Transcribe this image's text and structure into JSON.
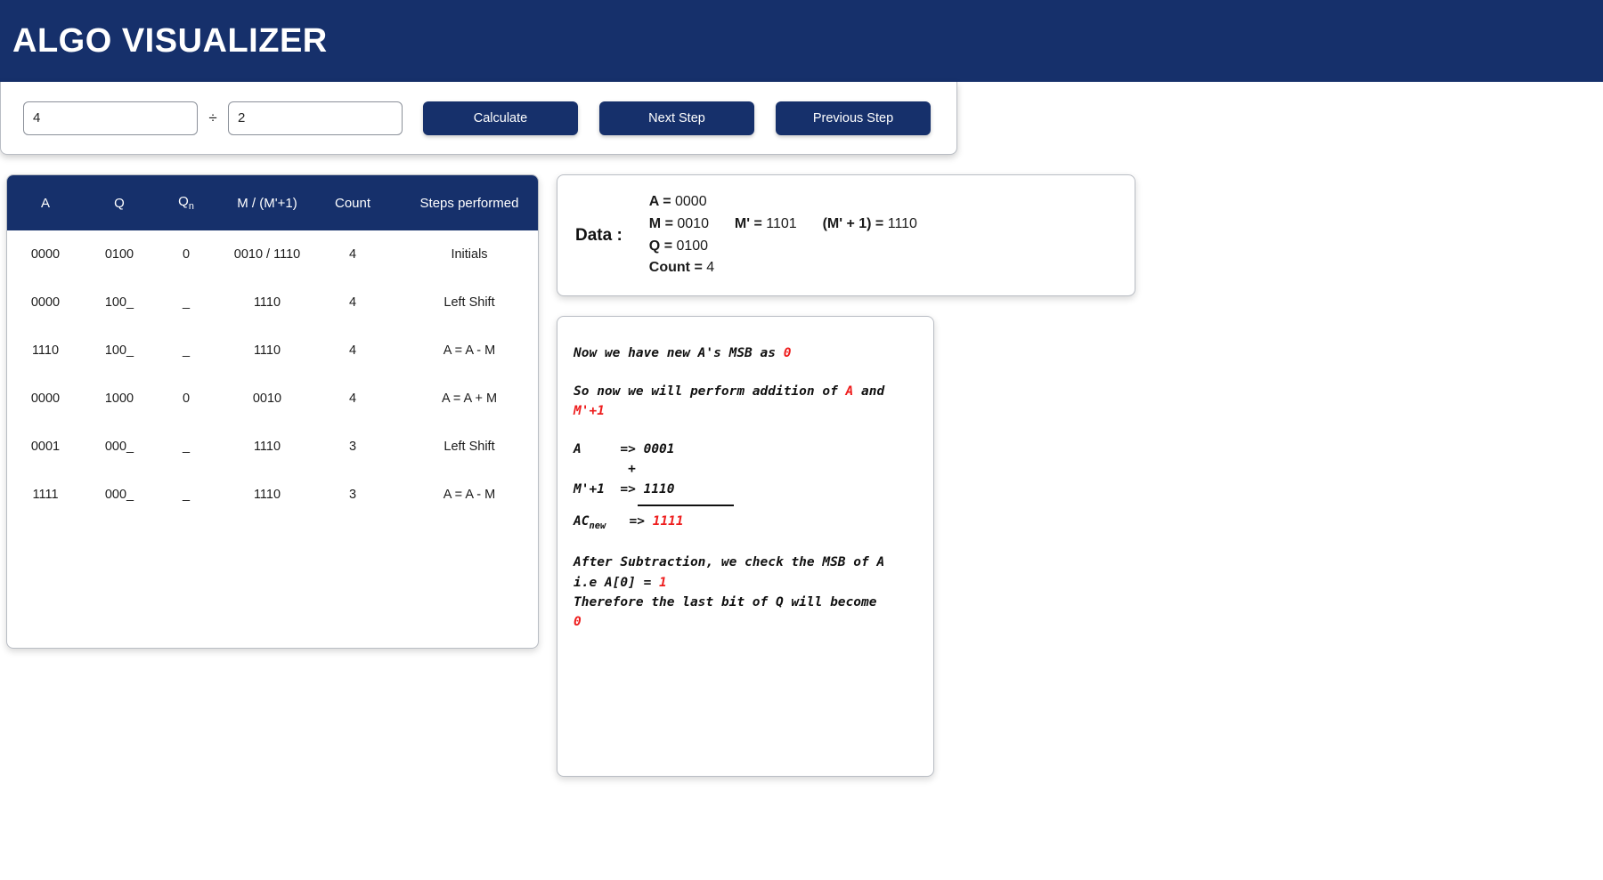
{
  "header": {
    "title": "ALGO VISUALIZER"
  },
  "controls": {
    "dividend_value": "4",
    "dividend_placeholder": "",
    "divisor_value": "2",
    "divisor_placeholder": "",
    "divide_symbol": "÷",
    "calculate_label": "Calculate",
    "next_step_label": "Next Step",
    "previous_step_label": "Previous Step"
  },
  "table": {
    "headers": [
      "A",
      "Q",
      "Qn",
      "M / (M'+1)",
      "Count",
      "Steps performed"
    ],
    "header_qn_base": "Q",
    "header_qn_sub": "n",
    "rows": [
      {
        "a": "0000",
        "q": "0100",
        "qn": "0",
        "m": "0010 / 1110",
        "count": "4",
        "step": "Initials"
      },
      {
        "a": "0000",
        "q": "100_",
        "qn": "_",
        "m": "1110",
        "count": "4",
        "step": "Left Shift"
      },
      {
        "a": "1110",
        "q": "100_",
        "qn": "_",
        "m": "1110",
        "count": "4",
        "step": "A = A - M"
      },
      {
        "a": "0000",
        "q": "1000",
        "qn": "0",
        "m": "0010",
        "count": "4",
        "step": "A = A + M"
      },
      {
        "a": "0001",
        "q": "000_",
        "qn": "_",
        "m": "1110",
        "count": "3",
        "step": "Left Shift"
      },
      {
        "a": "1111",
        "q": "000_",
        "qn": "_",
        "m": "1110",
        "count": "3",
        "step": "A = A - M"
      }
    ]
  },
  "data_panel": {
    "label": "Data :",
    "a_label": "A =",
    "a_value": "0000",
    "m_label": "M =",
    "m_value": "0010",
    "mprime_label": "M' =",
    "mprime_value": "1101",
    "mprime1_label": "(M' + 1) =",
    "mprime1_value": "1110",
    "q_label": "Q =",
    "q_value": "0100",
    "count_label": "Count =",
    "count_value": "4"
  },
  "explanation": {
    "line1_pre": "Now we have new A's MSB as ",
    "line1_red": "0",
    "line2_pre": "So now we will perform addition of ",
    "line2_red1": "A",
    "line2_mid": " and ",
    "line2_red2": "M'+1",
    "calc_a_label": "A",
    "calc_a_arrow": "=>",
    "calc_a_value": "0001",
    "calc_plus": "+",
    "calc_m_label": "M'+1",
    "calc_m_arrow": "=>",
    "calc_m_value": "1110",
    "calc_res_label_base": "AC",
    "calc_res_label_sub": "new",
    "calc_res_arrow": "=>",
    "calc_res_value": "1111",
    "after_line1": "After Subtraction, we check the MSB of A",
    "after_line2_pre": "i.e A[0] = ",
    "after_line2_red": "1",
    "after_line3": "Therefore the last bit of Q will become",
    "after_line4_red": "0"
  },
  "colors": {
    "brand": "#16306b",
    "accent_red": "#ee1d1d",
    "page_bg": "#ffffff",
    "card_border": "#b9bdc4"
  }
}
